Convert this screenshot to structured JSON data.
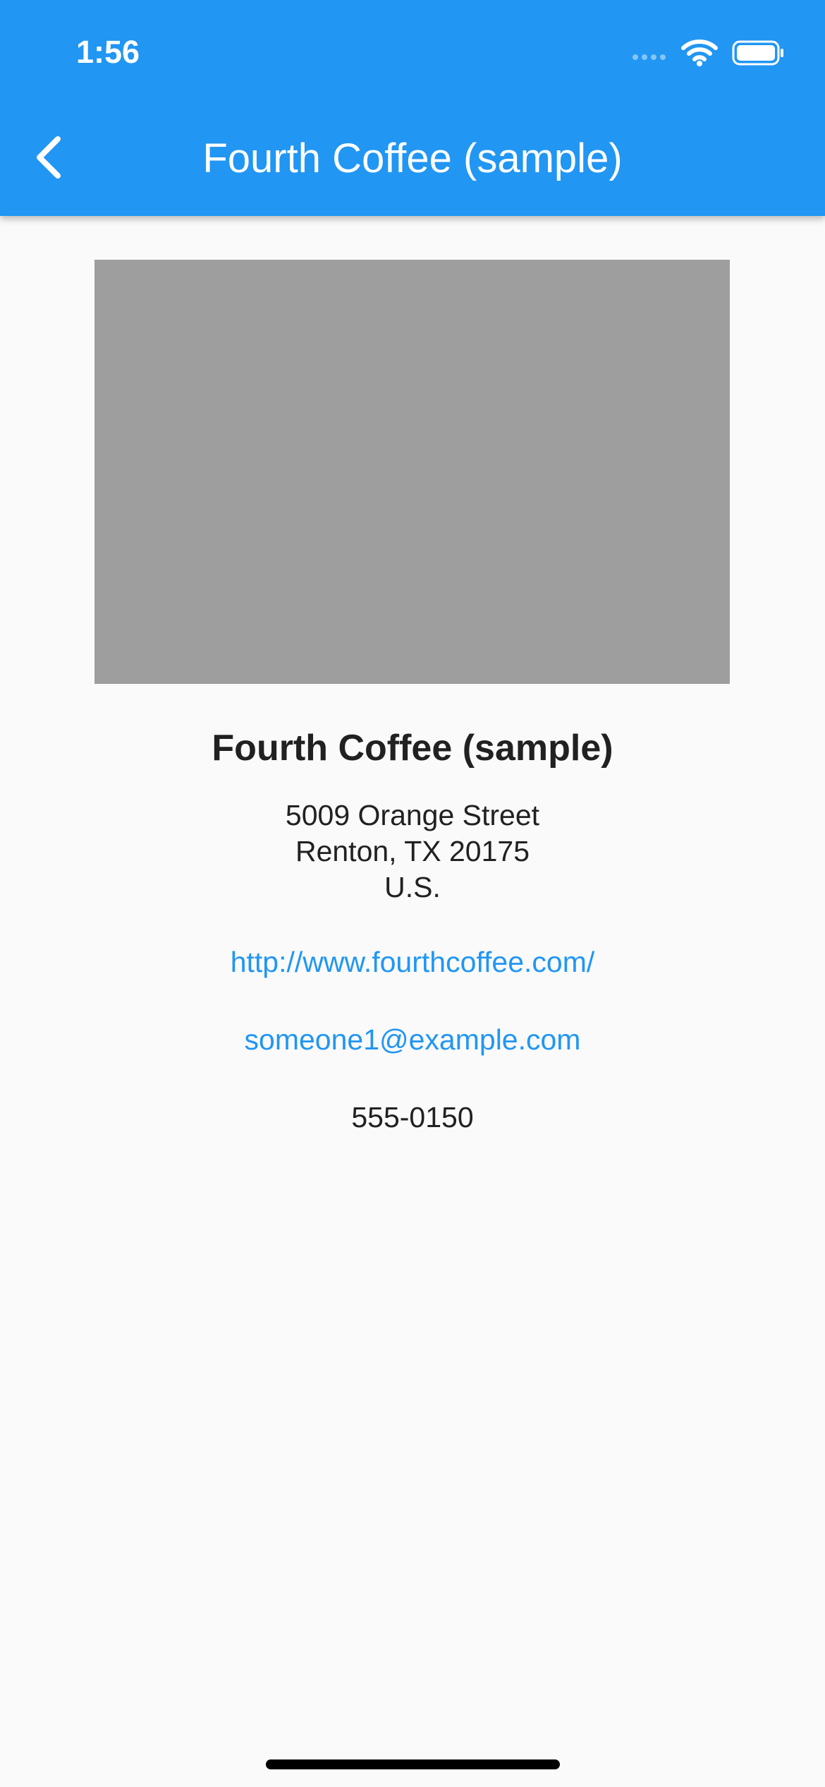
{
  "status_bar": {
    "time": "1:56",
    "icons": [
      "cellular-signal-icon",
      "wifi-icon",
      "battery-icon"
    ]
  },
  "app_bar": {
    "title": "Fourth Coffee (sample)",
    "back_icon": "chevron-left-icon"
  },
  "business": {
    "name": "Fourth Coffee (sample)",
    "address_lines": [
      "5009 Orange Street",
      "Renton, TX 20175",
      "U.S."
    ],
    "website": "http://www.fourthcoffee.com/",
    "email": "someone1@example.com",
    "phone": "555-0150"
  },
  "colors": {
    "app_bar": "#2196f3",
    "link": "#2196f3",
    "image_placeholder": "#9e9e9e",
    "background": "#fafafa",
    "text": "#212121"
  }
}
